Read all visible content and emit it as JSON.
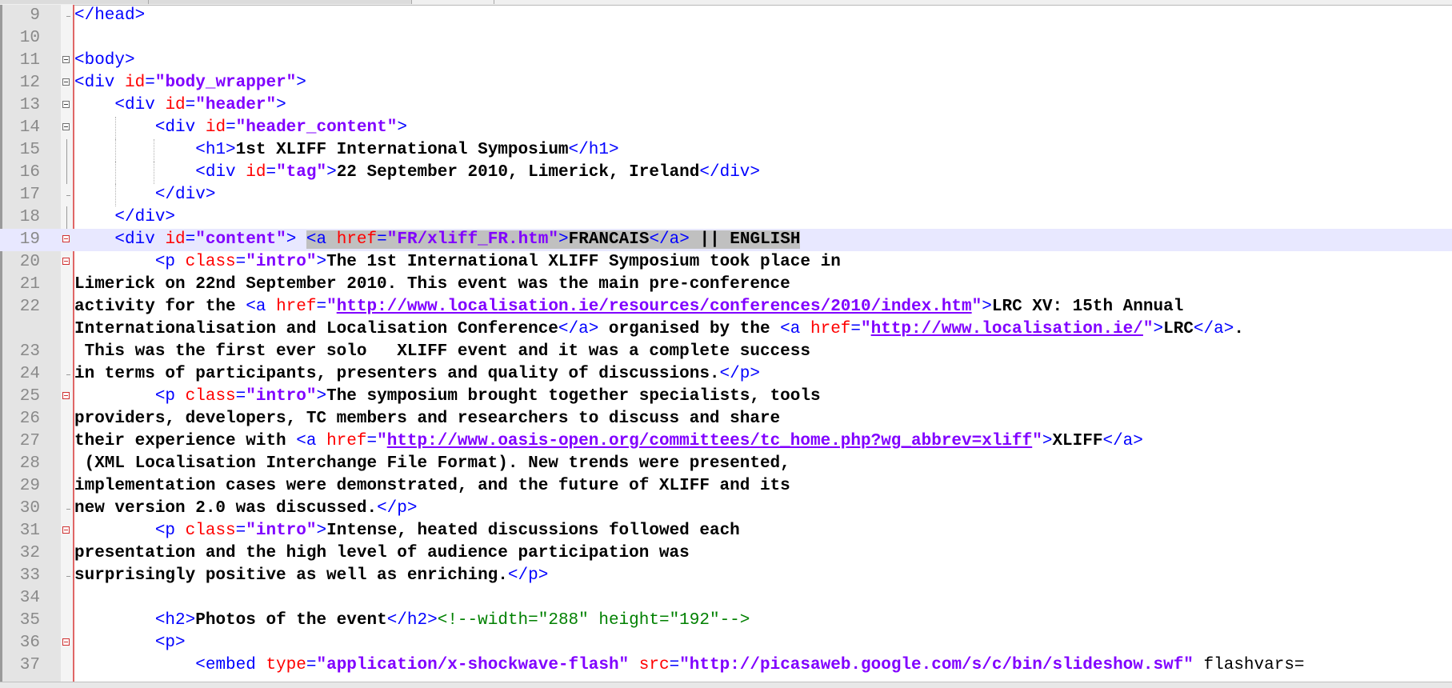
{
  "editor": {
    "lines": [
      {
        "n": "9",
        "fold": "end",
        "tokens": [
          {
            "c": "t",
            "s": "</head>"
          }
        ]
      },
      {
        "n": "10",
        "fold": "",
        "tokens": []
      },
      {
        "n": "11",
        "fold": "box",
        "tokens": [
          {
            "c": "t",
            "s": "<body>"
          }
        ]
      },
      {
        "n": "12",
        "fold": "box",
        "tokens": [
          {
            "c": "t",
            "s": "<div "
          },
          {
            "c": "a",
            "s": "id"
          },
          {
            "c": "t",
            "s": "="
          },
          {
            "c": "v",
            "s": "\"body_wrapper\""
          },
          {
            "c": "t",
            "s": ">"
          }
        ]
      },
      {
        "n": "13",
        "fold": "box",
        "tokens": [
          {
            "c": "p",
            "s": "    "
          },
          {
            "c": "t",
            "s": "<div "
          },
          {
            "c": "a",
            "s": "id"
          },
          {
            "c": "t",
            "s": "="
          },
          {
            "c": "v",
            "s": "\"header\""
          },
          {
            "c": "t",
            "s": ">"
          }
        ]
      },
      {
        "n": "14",
        "fold": "box",
        "tokens": [
          {
            "c": "p",
            "s": "        "
          },
          {
            "c": "t",
            "s": "<div "
          },
          {
            "c": "a",
            "s": "id"
          },
          {
            "c": "t",
            "s": "="
          },
          {
            "c": "v",
            "s": "\"header_content\""
          },
          {
            "c": "t",
            "s": ">"
          }
        ]
      },
      {
        "n": "15",
        "fold": "line",
        "tokens": [
          {
            "c": "p",
            "s": "            "
          },
          {
            "c": "t",
            "s": "<h1>"
          },
          {
            "c": "x",
            "s": "1st XLIFF International Symposium"
          },
          {
            "c": "t",
            "s": "</h1>"
          }
        ]
      },
      {
        "n": "16",
        "fold": "line",
        "tokens": [
          {
            "c": "p",
            "s": "            "
          },
          {
            "c": "t",
            "s": "<div "
          },
          {
            "c": "a",
            "s": "id"
          },
          {
            "c": "t",
            "s": "="
          },
          {
            "c": "v",
            "s": "\"tag\""
          },
          {
            "c": "t",
            "s": ">"
          },
          {
            "c": "x",
            "s": "22 September 2010, Limerick, Ireland"
          },
          {
            "c": "t",
            "s": "</div>"
          }
        ]
      },
      {
        "n": "17",
        "fold": "end",
        "tokens": [
          {
            "c": "p",
            "s": "        "
          },
          {
            "c": "t",
            "s": "</div>"
          }
        ]
      },
      {
        "n": "18",
        "fold": "line",
        "tokens": [
          {
            "c": "p",
            "s": "    "
          },
          {
            "c": "t",
            "s": "</div>"
          }
        ]
      },
      {
        "n": "19",
        "fold": "redbox",
        "hl": true,
        "tokens": [
          {
            "c": "p",
            "s": "    "
          },
          {
            "c": "t",
            "s": "<div "
          },
          {
            "c": "a",
            "s": "id"
          },
          {
            "c": "t",
            "s": "="
          },
          {
            "c": "v",
            "s": "\"content\""
          },
          {
            "c": "t",
            "s": "> "
          },
          {
            "c": "t sel",
            "s": "<a "
          },
          {
            "c": "a sel",
            "s": "href"
          },
          {
            "c": "t sel",
            "s": "="
          },
          {
            "c": "v sel",
            "s": "\"FR/xliff_FR.htm\""
          },
          {
            "c": "t sel",
            "s": ">"
          },
          {
            "c": "x sel",
            "s": "FRANCAIS"
          },
          {
            "c": "t sel",
            "s": "</a>"
          },
          {
            "c": "x sel",
            "s": " || ENGLISH"
          }
        ]
      },
      {
        "n": "20",
        "fold": "redbox",
        "tokens": [
          {
            "c": "p",
            "s": "        "
          },
          {
            "c": "t",
            "s": "<p "
          },
          {
            "c": "a",
            "s": "class"
          },
          {
            "c": "t",
            "s": "="
          },
          {
            "c": "v",
            "s": "\"intro\""
          },
          {
            "c": "t",
            "s": ">"
          },
          {
            "c": "x",
            "s": "The 1st International XLIFF Symposium took place in"
          }
        ]
      },
      {
        "n": "21",
        "fold": "",
        "tokens": [
          {
            "c": "x",
            "s": "Limerick on 22nd September 2010. This event was the main pre-conference"
          }
        ]
      },
      {
        "n": "22",
        "fold": "",
        "tokens": [
          {
            "c": "x",
            "s": "activity for the "
          },
          {
            "c": "t",
            "s": "<a "
          },
          {
            "c": "a",
            "s": "href"
          },
          {
            "c": "t",
            "s": "="
          },
          {
            "c": "v",
            "s": "\""
          },
          {
            "c": "v u",
            "s": "http://www.localisation.ie/resources/conferences/2010/index.htm"
          },
          {
            "c": "v",
            "s": "\""
          },
          {
            "c": "t",
            "s": ">"
          },
          {
            "c": "x",
            "s": "LRC XV: 15th Annual"
          }
        ]
      },
      {
        "n": "",
        "fold": "",
        "tokens": [
          {
            "c": "x",
            "s": "Internationalisation and Localisation Conference"
          },
          {
            "c": "t",
            "s": "</a>"
          },
          {
            "c": "x",
            "s": " organised by the "
          },
          {
            "c": "t",
            "s": "<a "
          },
          {
            "c": "a",
            "s": "href"
          },
          {
            "c": "t",
            "s": "="
          },
          {
            "c": "v",
            "s": "\""
          },
          {
            "c": "v u",
            "s": "http://www.localisation.ie/"
          },
          {
            "c": "v",
            "s": "\""
          },
          {
            "c": "t",
            "s": ">"
          },
          {
            "c": "x",
            "s": "LRC"
          },
          {
            "c": "t",
            "s": "</a>"
          },
          {
            "c": "x",
            "s": "."
          }
        ]
      },
      {
        "n": "23",
        "fold": "",
        "tokens": [
          {
            "c": "x",
            "s": " This was the first ever solo   XLIFF event and it was a complete success"
          }
        ]
      },
      {
        "n": "24",
        "fold": "end",
        "tokens": [
          {
            "c": "x",
            "s": "in terms of participants, presenters and quality of discussions."
          },
          {
            "c": "t",
            "s": "</p>"
          }
        ]
      },
      {
        "n": "25",
        "fold": "redbox",
        "tokens": [
          {
            "c": "p",
            "s": "        "
          },
          {
            "c": "t",
            "s": "<p "
          },
          {
            "c": "a",
            "s": "class"
          },
          {
            "c": "t",
            "s": "="
          },
          {
            "c": "v",
            "s": "\"intro\""
          },
          {
            "c": "t",
            "s": ">"
          },
          {
            "c": "x",
            "s": "The symposium brought together specialists, tools"
          }
        ]
      },
      {
        "n": "26",
        "fold": "",
        "tokens": [
          {
            "c": "x",
            "s": "providers, developers, TC members and researchers to discuss and share"
          }
        ]
      },
      {
        "n": "27",
        "fold": "",
        "tokens": [
          {
            "c": "x",
            "s": "their experience with "
          },
          {
            "c": "t",
            "s": "<a "
          },
          {
            "c": "a",
            "s": "href"
          },
          {
            "c": "t",
            "s": "="
          },
          {
            "c": "v",
            "s": "\""
          },
          {
            "c": "v u",
            "s": "http://www.oasis-open.org/committees/tc_home.php?wg_abbrev=xliff"
          },
          {
            "c": "v",
            "s": "\""
          },
          {
            "c": "t",
            "s": ">"
          },
          {
            "c": "x",
            "s": "XLIFF"
          },
          {
            "c": "t",
            "s": "</a>"
          }
        ]
      },
      {
        "n": "28",
        "fold": "",
        "tokens": [
          {
            "c": "x",
            "s": " (XML Localisation Interchange File Format). New trends were presented,"
          }
        ]
      },
      {
        "n": "29",
        "fold": "",
        "tokens": [
          {
            "c": "x",
            "s": "implementation cases were demonstrated, and the future of XLIFF and its"
          }
        ]
      },
      {
        "n": "30",
        "fold": "end",
        "tokens": [
          {
            "c": "x",
            "s": "new version 2.0 was discussed."
          },
          {
            "c": "t",
            "s": "</p>"
          }
        ]
      },
      {
        "n": "31",
        "fold": "redbox",
        "tokens": [
          {
            "c": "p",
            "s": "        "
          },
          {
            "c": "t",
            "s": "<p "
          },
          {
            "c": "a",
            "s": "class"
          },
          {
            "c": "t",
            "s": "="
          },
          {
            "c": "v",
            "s": "\"intro\""
          },
          {
            "c": "t",
            "s": ">"
          },
          {
            "c": "x",
            "s": "Intense, heated discussions followed each"
          }
        ]
      },
      {
        "n": "32",
        "fold": "",
        "tokens": [
          {
            "c": "x",
            "s": "presentation and the high level of audience participation was"
          }
        ]
      },
      {
        "n": "33",
        "fold": "end",
        "tokens": [
          {
            "c": "x",
            "s": "surprisingly positive as well as enriching."
          },
          {
            "c": "t",
            "s": "</p>"
          }
        ]
      },
      {
        "n": "34",
        "fold": "",
        "tokens": []
      },
      {
        "n": "35",
        "fold": "",
        "tokens": [
          {
            "c": "p",
            "s": "        "
          },
          {
            "c": "t",
            "s": "<h2>"
          },
          {
            "c": "x",
            "s": "Photos of the event"
          },
          {
            "c": "t",
            "s": "</h2>"
          },
          {
            "c": "c",
            "s": "<!--width=\"288\" height=\"192\"-->"
          }
        ]
      },
      {
        "n": "36",
        "fold": "redbox",
        "tokens": [
          {
            "c": "p",
            "s": "        "
          },
          {
            "c": "t",
            "s": "<p>"
          }
        ]
      },
      {
        "n": "37",
        "fold": "",
        "tokens": [
          {
            "c": "p",
            "s": "            "
          },
          {
            "c": "t",
            "s": "<embed "
          },
          {
            "c": "a",
            "s": "type"
          },
          {
            "c": "t",
            "s": "="
          },
          {
            "c": "v",
            "s": "\"application/x-shockwave-flash\""
          },
          {
            "c": "p",
            "s": " "
          },
          {
            "c": "a",
            "s": "src"
          },
          {
            "c": "t",
            "s": "="
          },
          {
            "c": "v",
            "s": "\"http://picasaweb.google.com/s/c/bin/slideshow.swf\""
          },
          {
            "c": "p",
            "s": " flashvars="
          }
        ]
      }
    ]
  }
}
